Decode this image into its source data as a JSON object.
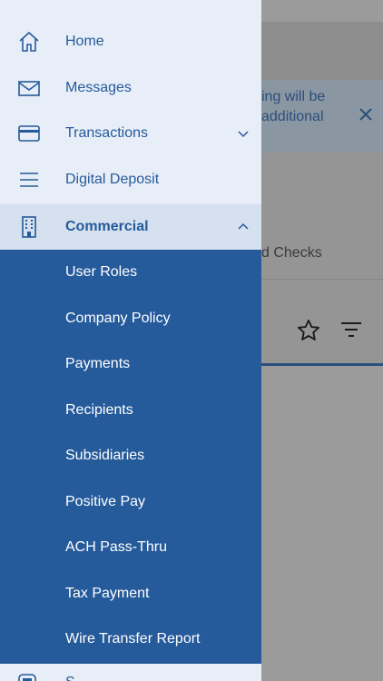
{
  "drawer": {
    "items": [
      {
        "label": "Home",
        "icon": "home-icon"
      },
      {
        "label": "Messages",
        "icon": "envelope-icon"
      },
      {
        "label": "Transactions",
        "icon": "credit-card-icon"
      },
      {
        "label": "Digital Deposit",
        "icon": "menu-lines-icon"
      },
      {
        "label": "Commercial",
        "icon": "building-icon"
      }
    ],
    "commercial_submenu": [
      {
        "label": "User Roles"
      },
      {
        "label": "Company Policy"
      },
      {
        "label": "Payments"
      },
      {
        "label": "Recipients"
      },
      {
        "label": "Subsidiaries"
      },
      {
        "label": "Positive Pay"
      },
      {
        "label": "ACH Pass-Thru"
      },
      {
        "label": "Tax Payment"
      },
      {
        "label": "Wire Transfer Report"
      }
    ],
    "partial_item": {
      "label": "S",
      "icon": "device-icon"
    }
  },
  "background": {
    "banner_line1": "ing will be",
    "banner_line2": "additional",
    "tab_text": "d Checks"
  },
  "colors": {
    "drawer_bg": "#e8eef7",
    "accent": "#255a9b",
    "submenu_bg": "#255a9b",
    "expanded_bg": "#d6e1ef"
  }
}
